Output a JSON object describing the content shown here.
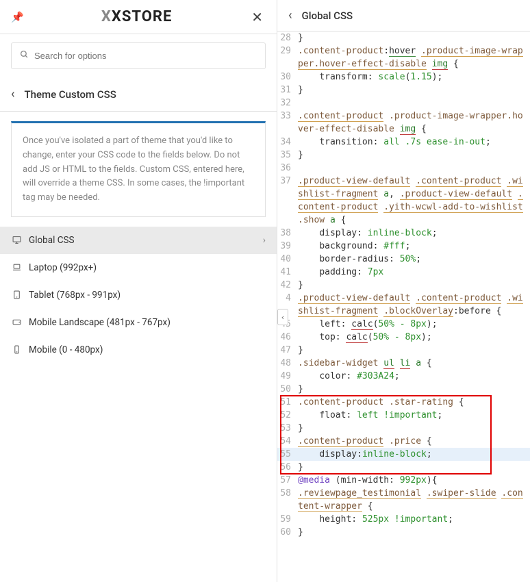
{
  "header": {
    "logo_text": "XSTORE"
  },
  "search": {
    "placeholder": "Search for options"
  },
  "section": {
    "title": "Theme Custom CSS"
  },
  "info": {
    "text": "Once you've isolated a part of theme that you'd like to change, enter your CSS code to the fields below. Do not add JS or HTML to the fields. Custom CSS, entered here, will override a theme CSS. In some cases, the !important tag may be needed."
  },
  "menu": [
    {
      "label": "Global CSS",
      "active": true,
      "icon": "desktop"
    },
    {
      "label": "Laptop (992px+)",
      "active": false,
      "icon": "laptop"
    },
    {
      "label": "Tablet (768px - 991px)",
      "active": false,
      "icon": "tablet"
    },
    {
      "label": "Mobile Landscape (481px - 767px)",
      "active": false,
      "icon": "mobile-l"
    },
    {
      "label": "Mobile (0 - 480px)",
      "active": false,
      "icon": "mobile"
    }
  ],
  "right_header": {
    "title": "Global CSS"
  },
  "code_lines": [
    {
      "n": 28,
      "seg": [
        {
          "t": "}",
          "c": "tok-brace"
        }
      ]
    },
    {
      "n": 29,
      "seg": [
        {
          "t": ".content-product",
          "c": "tok-sel"
        },
        {
          "t": ":",
          "c": "tok-punc"
        },
        {
          "t": "hover",
          "c": "tok-hover"
        },
        {
          "t": " ",
          "c": ""
        },
        {
          "t": ".product-image-wrapper.hover-effect-disable",
          "c": "tok-sel tok-ul"
        },
        {
          "t": " ",
          "c": ""
        },
        {
          "t": "img",
          "c": "tok-img"
        },
        {
          "t": " {",
          "c": "tok-brace"
        }
      ]
    },
    {
      "n": 30,
      "seg": [
        {
          "t": "    ",
          "c": ""
        },
        {
          "t": "transform",
          "c": "tok-prop"
        },
        {
          "t": ": ",
          "c": "tok-punc"
        },
        {
          "t": "scale",
          "c": "tok-val"
        },
        {
          "t": "(",
          "c": "tok-punc"
        },
        {
          "t": "1.15",
          "c": "tok-num"
        },
        {
          "t": ");",
          "c": "tok-punc"
        }
      ]
    },
    {
      "n": 31,
      "seg": [
        {
          "t": "}",
          "c": "tok-brace"
        }
      ]
    },
    {
      "n": 32,
      "seg": [
        {
          "t": "",
          "c": ""
        }
      ]
    },
    {
      "n": 33,
      "seg": [
        {
          "t": ".content-product",
          "c": "tok-sel tok-ul"
        },
        {
          "t": " ",
          "c": ""
        },
        {
          "t": ".product-image-wrapper.hover-effect-disable",
          "c": "tok-sel"
        },
        {
          "t": " ",
          "c": ""
        },
        {
          "t": "img",
          "c": "tok-img"
        },
        {
          "t": " {",
          "c": "tok-brace"
        }
      ]
    },
    {
      "n": 34,
      "seg": [
        {
          "t": "    ",
          "c": ""
        },
        {
          "t": "transition",
          "c": "tok-prop"
        },
        {
          "t": ": ",
          "c": "tok-punc"
        },
        {
          "t": "all .7s ease-in-out",
          "c": "tok-val"
        },
        {
          "t": ";",
          "c": "tok-punc"
        }
      ]
    },
    {
      "n": 35,
      "seg": [
        {
          "t": "}",
          "c": "tok-brace"
        }
      ]
    },
    {
      "n": 36,
      "seg": [
        {
          "t": "",
          "c": ""
        }
      ]
    },
    {
      "n": 37,
      "seg": [
        {
          "t": ".product-view-default",
          "c": "tok-sel tok-ul"
        },
        {
          "t": " ",
          "c": ""
        },
        {
          "t": ".content-product",
          "c": "tok-sel tok-ul"
        },
        {
          "t": " ",
          "c": ""
        },
        {
          "t": ".wishlist-fragment",
          "c": "tok-sel tok-ul"
        },
        {
          "t": " ",
          "c": ""
        },
        {
          "t": "a",
          "c": "tok-tag"
        },
        {
          "t": ",",
          "c": "tok-punc"
        },
        {
          "t": " ",
          "c": ""
        },
        {
          "t": ".product-view-default",
          "c": "tok-sel tok-ul"
        },
        {
          "t": " ",
          "c": ""
        },
        {
          "t": ".content-product",
          "c": "tok-sel tok-ul"
        },
        {
          "t": " ",
          "c": ""
        },
        {
          "t": ".yith-wcwl-add-to-wishlist",
          "c": "tok-sel tok-ul"
        },
        {
          "t": " ",
          "c": ""
        },
        {
          "t": ".show",
          "c": "tok-sel"
        },
        {
          "t": " ",
          "c": ""
        },
        {
          "t": "a",
          "c": "tok-tag"
        },
        {
          "t": " {",
          "c": "tok-brace"
        }
      ]
    },
    {
      "n": 38,
      "seg": [
        {
          "t": "    ",
          "c": ""
        },
        {
          "t": "display",
          "c": "tok-prop"
        },
        {
          "t": ": ",
          "c": "tok-punc"
        },
        {
          "t": "inline-block",
          "c": "tok-val"
        },
        {
          "t": ";",
          "c": "tok-punc"
        }
      ]
    },
    {
      "n": 39,
      "seg": [
        {
          "t": "    ",
          "c": ""
        },
        {
          "t": "background",
          "c": "tok-prop"
        },
        {
          "t": ": ",
          "c": "tok-punc"
        },
        {
          "t": "#fff",
          "c": "tok-val"
        },
        {
          "t": ";",
          "c": "tok-punc"
        }
      ]
    },
    {
      "n": 40,
      "seg": [
        {
          "t": "    ",
          "c": ""
        },
        {
          "t": "border-radius",
          "c": "tok-prop"
        },
        {
          "t": ": ",
          "c": "tok-punc"
        },
        {
          "t": "50%",
          "c": "tok-num"
        },
        {
          "t": ";",
          "c": "tok-punc"
        }
      ]
    },
    {
      "n": 41,
      "seg": [
        {
          "t": "    ",
          "c": ""
        },
        {
          "t": "padding",
          "c": "tok-prop"
        },
        {
          "t": ": ",
          "c": "tok-punc"
        },
        {
          "t": "7px",
          "c": "tok-num"
        }
      ]
    },
    {
      "n": 42,
      "seg": [
        {
          "t": "}",
          "c": "tok-brace"
        }
      ]
    },
    {
      "n": "",
      "seg": [
        {
          "t": "",
          "c": ""
        }
      ]
    },
    {
      "n": "4",
      "seg": [
        {
          "t": ".product-view-default",
          "c": "tok-sel tok-ul"
        },
        {
          "t": " ",
          "c": ""
        },
        {
          "t": ".content-product",
          "c": "tok-sel tok-ul"
        },
        {
          "t": " ",
          "c": ""
        },
        {
          "t": ".wishlist-fragment",
          "c": "tok-sel tok-ul"
        },
        {
          "t": " ",
          "c": ""
        },
        {
          "t": ".blockOverlay",
          "c": "tok-sel tok-bo"
        },
        {
          "t": ":",
          "c": "tok-punc"
        },
        {
          "t": "before",
          "c": "tok-pseudo"
        },
        {
          "t": " {",
          "c": "tok-brace"
        }
      ]
    },
    {
      "n": 45,
      "seg": [
        {
          "t": "    ",
          "c": ""
        },
        {
          "t": "left",
          "c": "tok-prop"
        },
        {
          "t": ": ",
          "c": "tok-punc"
        },
        {
          "t": "calc",
          "c": "tok-calc"
        },
        {
          "t": "(",
          "c": "tok-punc"
        },
        {
          "t": "50% - 8px",
          "c": "tok-num"
        },
        {
          "t": ");",
          "c": "tok-punc"
        }
      ]
    },
    {
      "n": 46,
      "seg": [
        {
          "t": "    ",
          "c": ""
        },
        {
          "t": "top",
          "c": "tok-prop"
        },
        {
          "t": ": ",
          "c": "tok-punc"
        },
        {
          "t": "calc",
          "c": "tok-calc"
        },
        {
          "t": "(",
          "c": "tok-punc"
        },
        {
          "t": "50% - 8px",
          "c": "tok-num"
        },
        {
          "t": ");",
          "c": "tok-punc"
        }
      ]
    },
    {
      "n": 47,
      "seg": [
        {
          "t": "}",
          "c": "tok-brace"
        }
      ]
    },
    {
      "n": 48,
      "seg": [
        {
          "t": ".sidebar-widget",
          "c": "tok-sel"
        },
        {
          "t": " ",
          "c": ""
        },
        {
          "t": "ul",
          "c": "tok-tag tok-ul-r"
        },
        {
          "t": " ",
          "c": ""
        },
        {
          "t": "li",
          "c": "tok-tag tok-ul-r"
        },
        {
          "t": " ",
          "c": ""
        },
        {
          "t": "a",
          "c": "tok-tag"
        },
        {
          "t": " {",
          "c": "tok-brace"
        }
      ]
    },
    {
      "n": 49,
      "seg": [
        {
          "t": "    ",
          "c": ""
        },
        {
          "t": "color",
          "c": "tok-prop"
        },
        {
          "t": ": ",
          "c": "tok-punc"
        },
        {
          "t": "#303A24",
          "c": "tok-val"
        },
        {
          "t": ";",
          "c": "tok-punc"
        }
      ]
    },
    {
      "n": 50,
      "seg": [
        {
          "t": "}",
          "c": "tok-brace"
        }
      ]
    },
    {
      "n": 51,
      "seg": [
        {
          "t": ".content-product",
          "c": "tok-sel"
        },
        {
          "t": " ",
          "c": ""
        },
        {
          "t": ".star-rating",
          "c": "tok-sel"
        },
        {
          "t": " {",
          "c": "tok-brace"
        }
      ]
    },
    {
      "n": 52,
      "seg": [
        {
          "t": "    ",
          "c": ""
        },
        {
          "t": "float",
          "c": "tok-prop"
        },
        {
          "t": ": ",
          "c": "tok-punc"
        },
        {
          "t": "left !important",
          "c": "tok-val"
        },
        {
          "t": ";",
          "c": "tok-punc"
        }
      ]
    },
    {
      "n": 53,
      "seg": [
        {
          "t": "}",
          "c": "tok-brace"
        }
      ]
    },
    {
      "n": 54,
      "seg": [
        {
          "t": ".content-product",
          "c": "tok-sel tok-ul"
        },
        {
          "t": " ",
          "c": ""
        },
        {
          "t": ".price",
          "c": "tok-sel"
        },
        {
          "t": " {",
          "c": "tok-brace"
        }
      ]
    },
    {
      "n": 55,
      "hl": true,
      "seg": [
        {
          "t": "    ",
          "c": ""
        },
        {
          "t": "display",
          "c": "tok-prop"
        },
        {
          "t": ":",
          "c": "tok-punc"
        },
        {
          "t": "inline-block",
          "c": "tok-val"
        },
        {
          "t": ";",
          "c": "tok-punc"
        }
      ]
    },
    {
      "n": 56,
      "seg": [
        {
          "t": "}",
          "c": "tok-brace"
        }
      ]
    },
    {
      "n": 57,
      "seg": [
        {
          "t": "@media",
          "c": "tok-media"
        },
        {
          "t": " (",
          "c": "tok-punc"
        },
        {
          "t": "min-width",
          "c": "tok-prop"
        },
        {
          "t": ": ",
          "c": "tok-punc"
        },
        {
          "t": "992px",
          "c": "tok-num"
        },
        {
          "t": "){",
          "c": "tok-punc"
        }
      ]
    },
    {
      "n": 58,
      "seg": [
        {
          "t": ".reviewpage_testimonial",
          "c": "tok-sel tok-ul"
        },
        {
          "t": " ",
          "c": ""
        },
        {
          "t": ".swiper-slide",
          "c": "tok-sel tok-ul"
        },
        {
          "t": " ",
          "c": ""
        },
        {
          "t": ".content-wrapper",
          "c": "tok-sel tok-ul"
        },
        {
          "t": " {",
          "c": "tok-brace"
        }
      ]
    },
    {
      "n": 59,
      "seg": [
        {
          "t": "    ",
          "c": ""
        },
        {
          "t": "height",
          "c": "tok-prop"
        },
        {
          "t": ": ",
          "c": "tok-punc"
        },
        {
          "t": "525px !important",
          "c": "tok-num"
        },
        {
          "t": ";",
          "c": "tok-punc"
        }
      ]
    },
    {
      "n": 60,
      "seg": [
        {
          "t": "}",
          "c": "tok-brace"
        }
      ]
    }
  ],
  "redbox": {
    "top_line": 51,
    "bottom_line": 56
  }
}
